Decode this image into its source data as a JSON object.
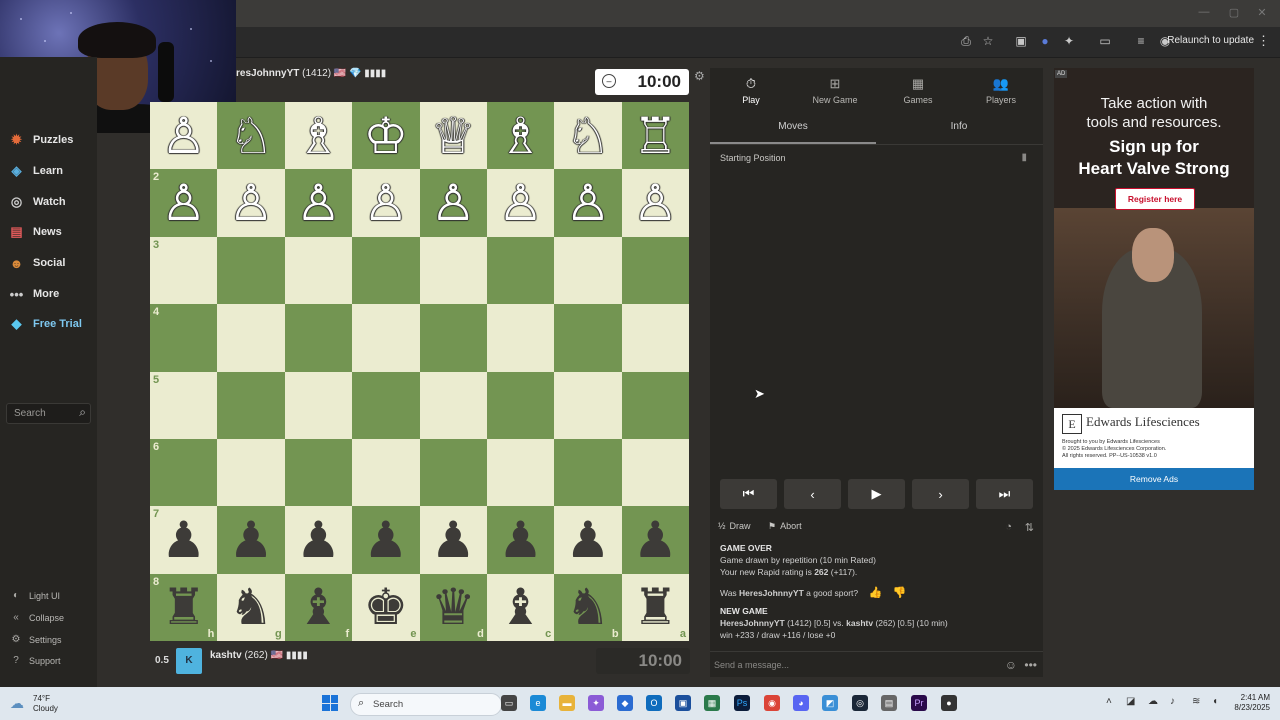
{
  "browser": {
    "relaunch_label": "Relaunch to update"
  },
  "sidebar": {
    "items": [
      {
        "label": "Puzzles",
        "icon": "puzzle-icon"
      },
      {
        "label": "Learn",
        "icon": "learn-icon"
      },
      {
        "label": "Watch",
        "icon": "watch-icon"
      },
      {
        "label": "News",
        "icon": "news-icon"
      },
      {
        "label": "Social",
        "icon": "social-icon"
      },
      {
        "label": "More",
        "icon": "more-icon"
      },
      {
        "label": "Free Trial",
        "icon": "diamond-icon"
      }
    ],
    "search_placeholder": "Search",
    "bottom": [
      {
        "label": "Light UI",
        "icon": "light-ui-icon"
      },
      {
        "label": "Collapse",
        "icon": "collapse-icon"
      },
      {
        "label": "Settings",
        "icon": "gear-icon"
      },
      {
        "label": "Support",
        "icon": "support-icon"
      }
    ]
  },
  "top_player": {
    "name": "resJohnnyYT",
    "rating": "(1412)",
    "badges": "🇺🇸 💎 ▮▮▮▮",
    "clock": "10:00"
  },
  "bottom_player": {
    "score": "0.5",
    "name": "kashtv",
    "rating": "(262)",
    "badges": "🇺🇸 ▮▮▮▮",
    "clock": "10:00"
  },
  "board": {
    "ranks": [
      "",
      "2",
      "3",
      "4",
      "5",
      "6",
      "7",
      "8"
    ],
    "files": [
      "h",
      "g",
      "f",
      "e",
      "d",
      "c",
      "b",
      "a"
    ],
    "rows": [
      [
        "wP",
        "wN",
        "wB",
        "wK",
        "wQ",
        "wB",
        "wN",
        "wR"
      ],
      [
        "wP",
        "wP",
        "wP",
        "wP",
        "wP",
        "wP",
        "wP",
        "wP"
      ],
      [
        "",
        "",
        "",
        "",
        "",
        "",
        "",
        ""
      ],
      [
        "",
        "",
        "",
        "",
        "",
        "",
        "",
        ""
      ],
      [
        "",
        "",
        "",
        "",
        "",
        "",
        "",
        ""
      ],
      [
        "",
        "",
        "",
        "",
        "",
        "",
        "",
        ""
      ],
      [
        "bP",
        "bP",
        "bP",
        "bP",
        "bP",
        "bP",
        "bP",
        "bP"
      ],
      [
        "bR",
        "bN",
        "bB",
        "bK",
        "bQ",
        "bB",
        "bN",
        "bR"
      ]
    ]
  },
  "panel": {
    "tabs": [
      {
        "label": "Play",
        "icon": "clock-icon"
      },
      {
        "label": "New Game",
        "icon": "plus-icon"
      },
      {
        "label": "Games",
        "icon": "board-icon"
      },
      {
        "label": "Players",
        "icon": "players-icon"
      }
    ],
    "subtabs": [
      "Moves",
      "Info"
    ],
    "starting_position": "Starting Position",
    "actions": {
      "draw": "Draw",
      "abort": "Abort"
    },
    "chat": {
      "game_over_title": "GAME OVER",
      "game_over_line": "Game drawn by repetition (10 min Rated)",
      "rating_prefix": "Your new Rapid rating is ",
      "rating_value": "262",
      "rating_delta": " (+117).",
      "sport_prefix": "Was ",
      "sport_name": "HeresJohnnyYT",
      "sport_suffix": " a good sport?",
      "new_game_title": "NEW GAME",
      "new_game_white": "HeresJohnnyYT",
      "new_game_mid": " (1412) [0.5] vs. ",
      "new_game_black": "kashtv",
      "new_game_end": " (262) [0.5] (10 min)",
      "record": "win +233 / draw +116 / lose +0"
    },
    "message_placeholder": "Send a message..."
  },
  "ad": {
    "badge": "AD",
    "headline1": "Take action with",
    "headline2": "tools and resources.",
    "headline3": "Sign up for",
    "headline4": "Heart Valve Strong",
    "cta": "Register here",
    "brand": "Edwards Lifesciences",
    "logo_letter": "E",
    "small1": "Brought to you by Edwards Lifesciences",
    "small2": "© 2025 Edwards Lifesciences Corporation.",
    "small3": "All rights reserved. PP--US-10538 v1.0",
    "remove": "Remove Ads"
  },
  "taskbar": {
    "temp": "74°F",
    "condition": "Cloudy",
    "search_label": "Search",
    "time": "2:41 AM",
    "date": "8/23/2025"
  }
}
